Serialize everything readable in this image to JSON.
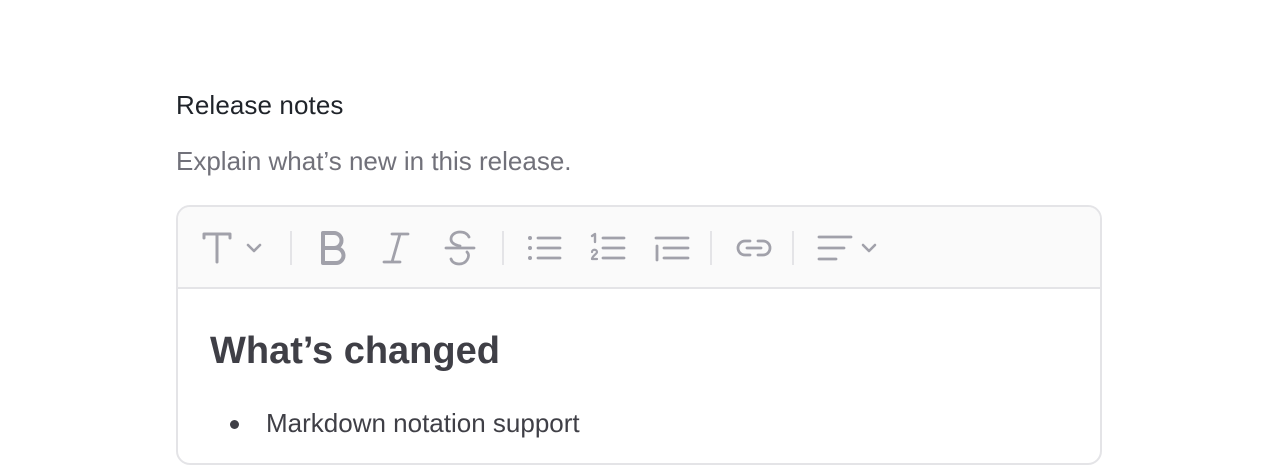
{
  "field": {
    "label": "Release notes",
    "help_text": "Explain what’s new in this release."
  },
  "toolbar": {
    "buttons": [
      {
        "name": "text-style-dropdown",
        "icon": "text-style-icon"
      },
      {
        "name": "bold-button",
        "icon": "bold-icon"
      },
      {
        "name": "italic-button",
        "icon": "italic-icon"
      },
      {
        "name": "strikethrough-button",
        "icon": "strikethrough-icon"
      },
      {
        "name": "bullet-list-button",
        "icon": "bullet-list-icon"
      },
      {
        "name": "numbered-list-button",
        "icon": "numbered-list-icon"
      },
      {
        "name": "indent-button",
        "icon": "indent-icon"
      },
      {
        "name": "link-button",
        "icon": "link-icon"
      },
      {
        "name": "align-dropdown",
        "icon": "align-left-icon"
      }
    ],
    "icon_color": "#a1a1aa"
  },
  "content": {
    "heading": "What’s changed",
    "bullets": [
      "Markdown notation support"
    ]
  }
}
